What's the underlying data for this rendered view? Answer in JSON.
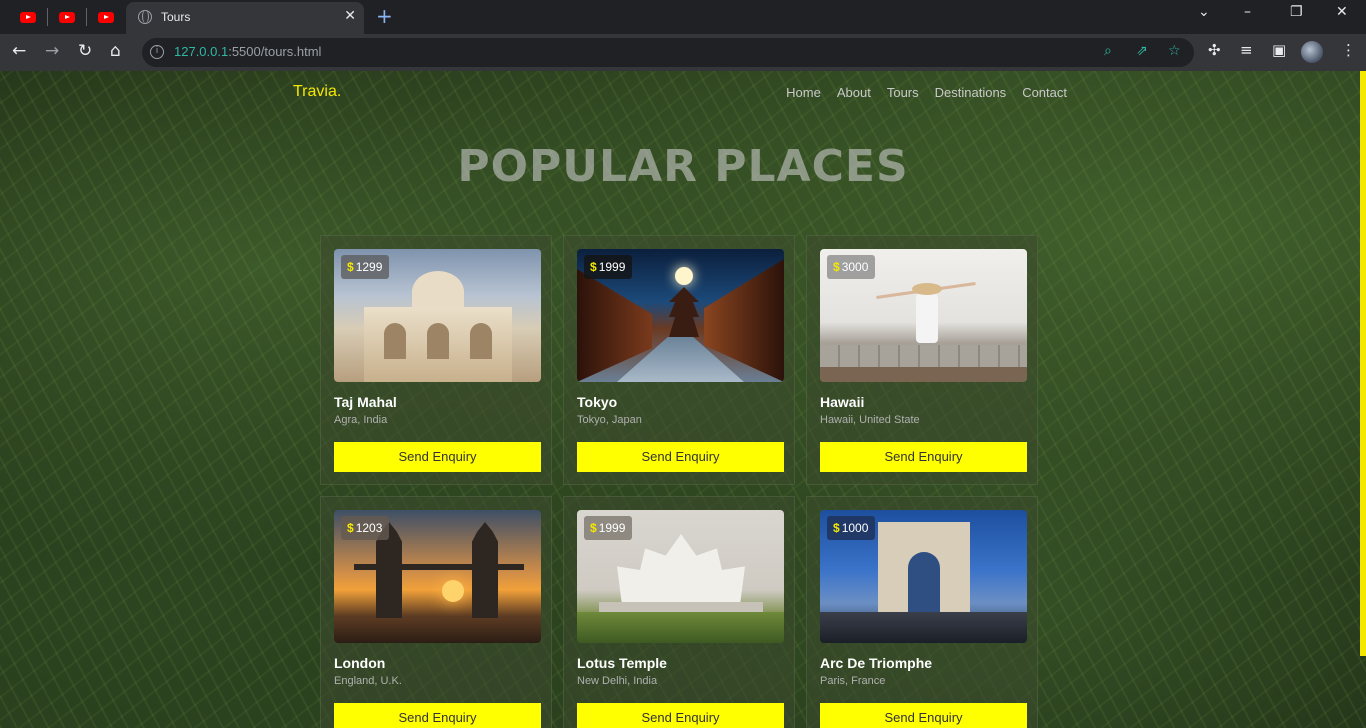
{
  "browser": {
    "tab_title": "Tours",
    "url_host": "127.0.0.1",
    "url_rest": ":5500/tours.html",
    "pinned_tabs": [
      "youtube-icon",
      "youtube-icon",
      "youtube-icon"
    ]
  },
  "site": {
    "logo": "Travia.",
    "nav": [
      "Home",
      "About",
      "Tours",
      "Destinations",
      "Contact"
    ],
    "heading": "POPULAR PLACES",
    "accent": "#ffff00"
  },
  "cards": [
    {
      "price": "1299",
      "title": "Taj Mahal",
      "location": "Agra, India",
      "button": "Send Enquiry"
    },
    {
      "price": "1999",
      "title": "Tokyo",
      "location": "Tokyo, Japan",
      "button": "Send Enquiry"
    },
    {
      "price": "3000",
      "title": "Hawaii",
      "location": "Hawaii, United State",
      "button": "Send Enquiry"
    },
    {
      "price": "1203",
      "title": "London",
      "location": "England, U.K.",
      "button": "Send Enquiry"
    },
    {
      "price": "1999",
      "title": "Lotus Temple",
      "location": "New Delhi, India",
      "button": "Send Enquiry"
    },
    {
      "price": "1000",
      "title": "Arc De Triomphe",
      "location": "Paris, France",
      "button": "Send Enquiry"
    }
  ]
}
